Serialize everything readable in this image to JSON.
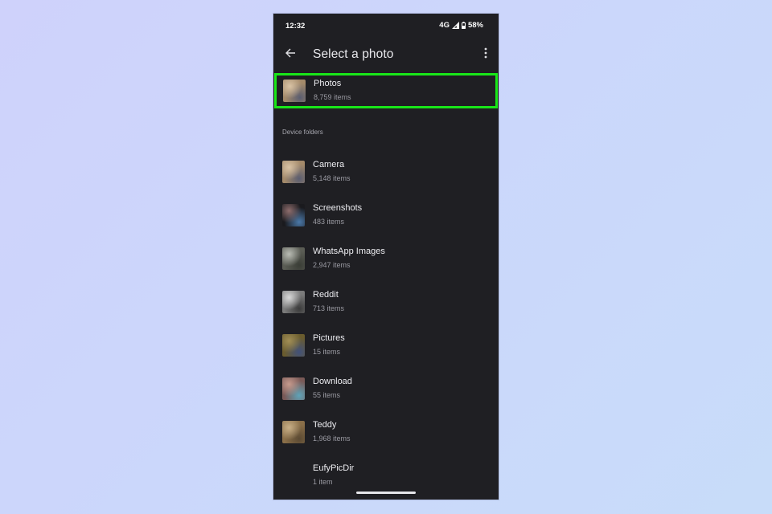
{
  "status_bar": {
    "time": "12:32",
    "network": "4G",
    "battery": "58%",
    "icons": [
      "signal-icon",
      "battery-icon"
    ]
  },
  "app_bar": {
    "back_icon": "arrow-left-icon",
    "title": "Select a photo",
    "more_icon": "more-vertical-icon"
  },
  "highlight_color": "#19e619",
  "featured": {
    "name": "Photos",
    "count": "8,759 items",
    "thumb_colors": [
      "#a48a6a",
      "#d9c3a5",
      "#5a5d70"
    ]
  },
  "section_header": "Device folders",
  "folders": [
    {
      "name": "Camera",
      "count": "5,148 items",
      "thumb_colors": [
        "#a48a6a",
        "#d9c3a5",
        "#5a5d70"
      ]
    },
    {
      "name": "Screenshots",
      "count": "483 items",
      "thumb_colors": [
        "#1a1a1e",
        "#8e6d6d",
        "#4a78a8"
      ]
    },
    {
      "name": "WhatsApp Images",
      "count": "2,947 items",
      "thumb_colors": [
        "#5b5d55",
        "#b9bcb4",
        "#3a3d36"
      ]
    },
    {
      "name": "Reddit",
      "count": "713 items",
      "thumb_colors": [
        "#7b7b7b",
        "#d9d9d9",
        "#3b3b3b"
      ]
    },
    {
      "name": "Pictures",
      "count": "15 items",
      "thumb_colors": [
        "#6a5c2e",
        "#a18e56",
        "#41517a"
      ]
    },
    {
      "name": "Download",
      "count": "55 items",
      "thumb_colors": [
        "#7a5a57",
        "#c69a8d",
        "#5fa3b8"
      ]
    },
    {
      "name": "Teddy",
      "count": "1,968 items",
      "thumb_colors": [
        "#8a6f49",
        "#c9b088",
        "#5b4a33"
      ]
    },
    {
      "name": "EufyPicDir",
      "count": "1 item",
      "thumb_colors": []
    }
  ]
}
